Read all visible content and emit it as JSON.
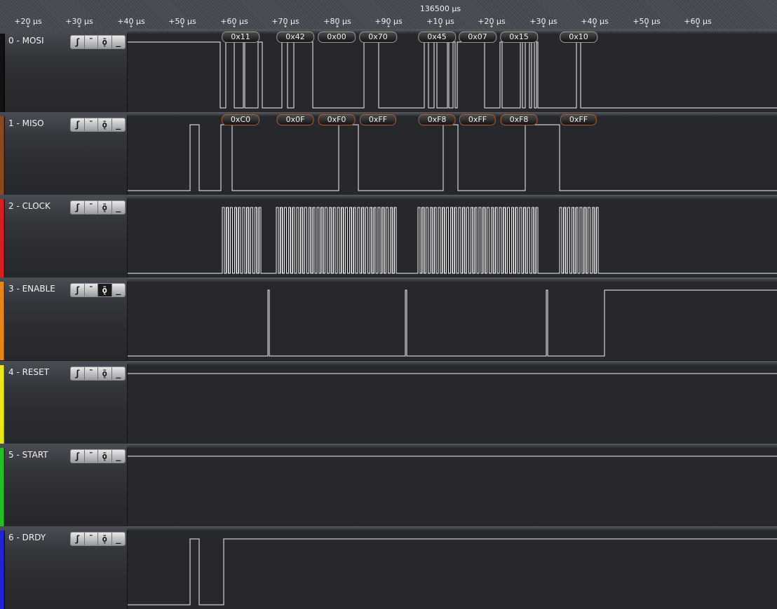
{
  "ruler": {
    "title": "136500 µs",
    "ticks": [
      "+20 µs",
      "+30 µs",
      "+40 µs",
      "+50 µs",
      "+60 µs",
      "+70 µs",
      "+80 µs",
      "+90 µs",
      "+10 µs",
      "+20 µs",
      "+30 µs",
      "+40 µs",
      "+50 µs",
      "+60 µs"
    ]
  },
  "trigger_buttons": [
    "rising-edge-icon",
    "high-level-icon",
    "falling-edge-icon",
    "low-level-icon"
  ],
  "channels": [
    {
      "name": "0 - MOSI",
      "color": "#111111",
      "active_trigger": -1,
      "decoded": [
        "0x11",
        "0x42",
        "0x00",
        "0x70",
        "0x45",
        "0x07",
        "0x15",
        "0x10"
      ]
    },
    {
      "name": "1 - MISO",
      "color": "#8a4a1e",
      "active_trigger": -1,
      "decoded": [
        "0xC0",
        "0x0F",
        "0xF0",
        "0xFF",
        "0xF8",
        "0xFF",
        "0xF8",
        "0xFF"
      ]
    },
    {
      "name": "2 - CLOCK",
      "color": "#d81e1e",
      "active_trigger": -1,
      "decoded": []
    },
    {
      "name": "3 - ENABLE",
      "color": "#e8841a",
      "active_trigger": 2,
      "decoded": []
    },
    {
      "name": "4 - RESET",
      "color": "#e8e81a",
      "active_trigger": -1,
      "decoded": []
    },
    {
      "name": "5 - START",
      "color": "#22c022",
      "active_trigger": -1,
      "decoded": []
    },
    {
      "name": "6 - DRDY",
      "color": "#2222d8",
      "active_trigger": -1,
      "decoded": []
    }
  ]
}
